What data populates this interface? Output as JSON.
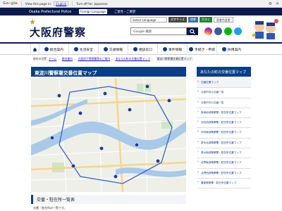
{
  "translate_bar": {
    "view_prefix": "View this page in:",
    "view_language": "English",
    "turn_off_label": "Turn off for: Japanese"
  },
  "top_strip": {
    "org_name": "Osaka Prefectural Police",
    "foreign_language": "Foreign Language",
    "opinion": "ご意見・ご要望"
  },
  "header": {
    "site_title": "大阪府警察",
    "lang_select_label": "Select Language",
    "chips": [
      "文字サイズ",
      "標準",
      "大きく",
      "背景色変更"
    ],
    "search_placeholder": "Google 検索"
  },
  "nav": {
    "items": [
      "総合案内",
      "生活安全",
      "交通情報",
      "相談窓口",
      "事件情報",
      "手続き・申請",
      "採用案内"
    ]
  },
  "breadcrumb": {
    "prefix": "現在の位置",
    "items": [
      "ホーム",
      "総合案内",
      "大阪府下警察署等のご案内",
      "あなたの町の交番位置マップ",
      "東淀川警察署交番位置マップ"
    ]
  },
  "main": {
    "heading": "東淀川警察署交番位置マップ",
    "list_heading": "交番・駐在所一覧表",
    "list_text": "交番・駐在所の一覧です。"
  },
  "sidebar": {
    "heading": "あなたの町の交番位置マップ",
    "items": [
      "交番位置マップ",
      "大阪市内の交番一覧",
      "大阪市外の交番一覧",
      "阪南地域警察署・駐在所位置マップ",
      "河内西部警察署・駐在所位置マップ",
      "河内東部警察署・駐在所位置マップ",
      "泉州北部警察署・駐在所位置マップ",
      "泉州南部警察署・駐在所位置マップ",
      "北摂東部警察署・駐在所位置マップ",
      "北摂西部警察署・駐在所位置マップ",
      "豊能警察署・駐在所位置マップ"
    ]
  },
  "colors": {
    "navy": "#0b1a4a",
    "blue": "#0b3e8a"
  }
}
